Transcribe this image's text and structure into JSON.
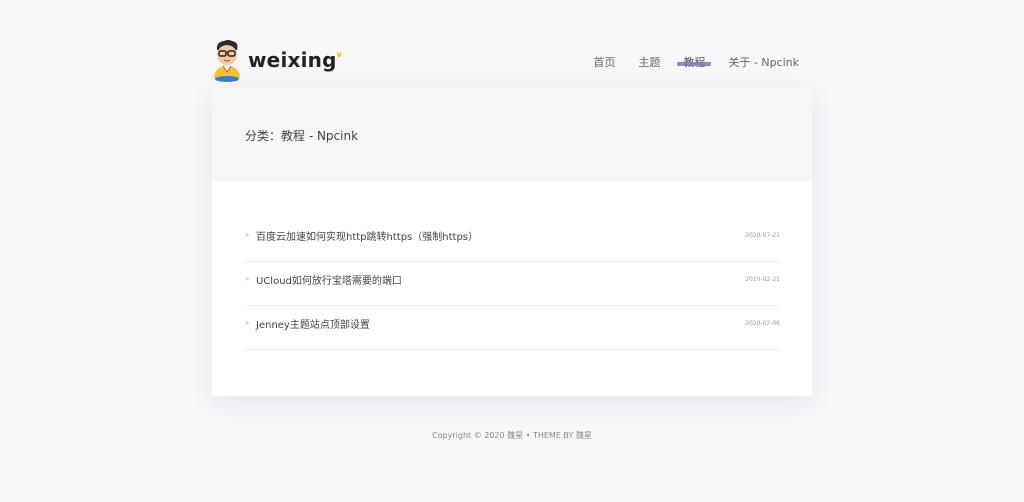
{
  "site": {
    "logo_text": "weixing",
    "logo_sup": "v"
  },
  "nav": {
    "items": [
      {
        "label": "首页"
      },
      {
        "label": "主题"
      },
      {
        "label": "教程"
      },
      {
        "label": "关于 - Npcink"
      }
    ],
    "active_index": 2
  },
  "page": {
    "category_title": "分类：教程 - Npcink"
  },
  "posts": [
    {
      "bullet": "»",
      "title": "百度云加速如何实现http跳转https（强制https）",
      "date": "2020-07-21"
    },
    {
      "bullet": "»",
      "title": "UCloud如何放行宝塔需要的端口",
      "date": "2020-02-21"
    },
    {
      "bullet": "»",
      "title": "Jenney主题站点顶部设置",
      "date": "2020-02-06"
    }
  ],
  "footer": {
    "text": "Copyright © 2020 魏星 • THEME BY 魏星"
  },
  "colors": {
    "accent": "#7b79b8",
    "background": "#f7f7fa",
    "card": "#ffffff"
  }
}
